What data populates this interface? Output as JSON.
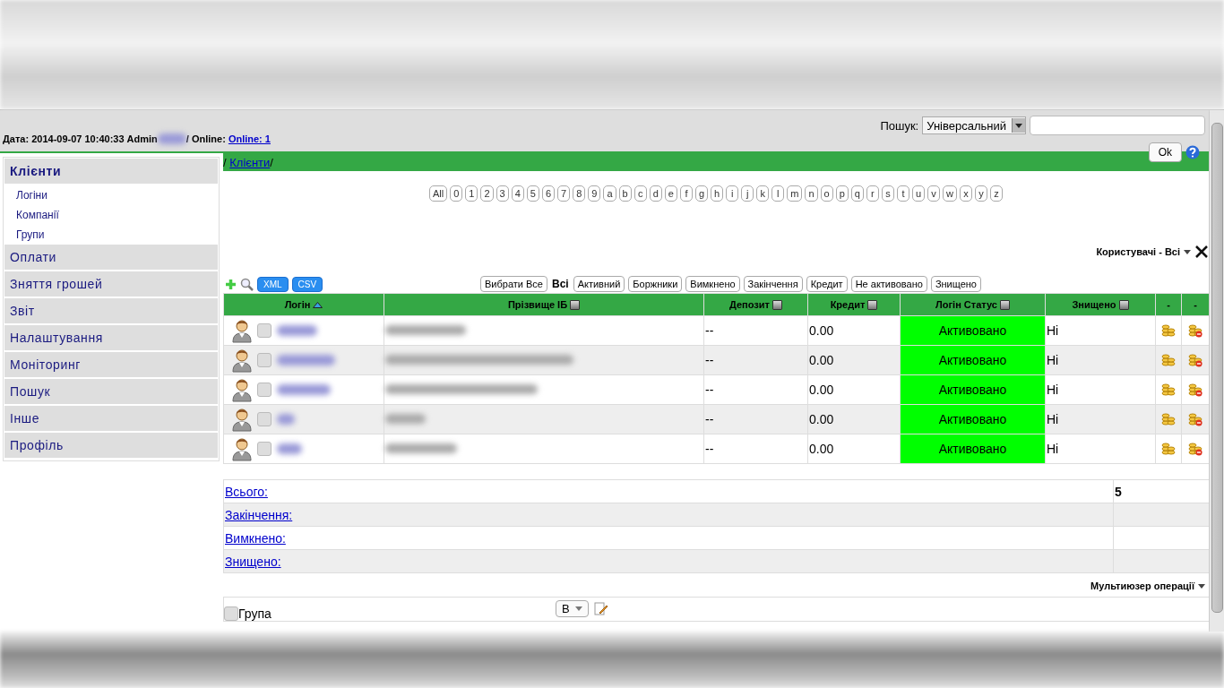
{
  "header": {
    "date_text": "Дата: 2014-09-07 10:40:33 Admin",
    "online_label": "/ Online:",
    "online_link": "Online: 1"
  },
  "search": {
    "label": "Пошук:",
    "mode": "Універсальний",
    "ok": "Ok"
  },
  "sidebar": {
    "items": [
      {
        "label": "Клієнти",
        "expanded": true,
        "children": [
          {
            "label": "Логіни"
          },
          {
            "label": "Компанії"
          },
          {
            "label": "Групи"
          }
        ]
      },
      {
        "label": "Оплати",
        "expanded": false
      },
      {
        "label": "Зняття грошей",
        "expanded": false
      },
      {
        "label": "Звіт",
        "expanded": false
      },
      {
        "label": "Налаштування",
        "expanded": false
      },
      {
        "label": "Моніторинг",
        "expanded": false
      },
      {
        "label": "Пошук",
        "expanded": false
      },
      {
        "label": "Інше",
        "expanded": false
      },
      {
        "label": "Профіль",
        "expanded": false
      }
    ]
  },
  "breadcrumb": {
    "prefix": "/",
    "link": "Клієнти",
    "suffix": "/"
  },
  "letters": [
    "All",
    "0",
    "1",
    "2",
    "3",
    "4",
    "5",
    "6",
    "7",
    "8",
    "9",
    "a",
    "b",
    "c",
    "d",
    "e",
    "f",
    "g",
    "h",
    "i",
    "j",
    "k",
    "l",
    "m",
    "n",
    "o",
    "p",
    "q",
    "r",
    "s",
    "t",
    "u",
    "v",
    "w",
    "x",
    "y",
    "z"
  ],
  "view_title": "Користувачі - Всі",
  "export_buttons": [
    "XML",
    "CSV"
  ],
  "filters": [
    {
      "label": "Вибрати Все",
      "selected": false
    },
    {
      "label": "Всі",
      "selected": true
    },
    {
      "label": "Активний",
      "selected": false
    },
    {
      "label": "Боржники",
      "selected": false
    },
    {
      "label": "Вимкнено",
      "selected": false
    },
    {
      "label": "Закінчення",
      "selected": false
    },
    {
      "label": "Кредит",
      "selected": false
    },
    {
      "label": "Не активовано",
      "selected": false
    },
    {
      "label": "Знищено",
      "selected": false
    }
  ],
  "table": {
    "columns": [
      {
        "label": "Логін",
        "kind": "sort"
      },
      {
        "label": "Прізвище ІБ",
        "kind": "toggle"
      },
      {
        "label": "Депозит",
        "kind": "toggle"
      },
      {
        "label": "Кредит",
        "kind": "toggle"
      },
      {
        "label": "Логін Статус",
        "kind": "toggle"
      },
      {
        "label": "Знищено",
        "kind": "toggle"
      },
      {
        "label": "-",
        "kind": "plain"
      },
      {
        "label": "-",
        "kind": "plain"
      }
    ],
    "rows": [
      {
        "checked": false,
        "deposit": "--",
        "credit": "0.00",
        "status": "Активовано",
        "destroyed": "Ні"
      },
      {
        "checked": false,
        "deposit": "--",
        "credit": "0.00",
        "status": "Активовано",
        "destroyed": "Ні"
      },
      {
        "checked": false,
        "deposit": "--",
        "credit": "0.00",
        "status": "Активовано",
        "destroyed": "Ні"
      },
      {
        "checked": false,
        "deposit": "--",
        "credit": "0.00",
        "status": "Активовано",
        "destroyed": "Ні"
      },
      {
        "checked": false,
        "deposit": "--",
        "credit": "0.00",
        "status": "Активовано",
        "destroyed": "Ні"
      }
    ]
  },
  "summary": [
    {
      "label": "Всього:",
      "value": "5"
    },
    {
      "label": "Закінчення:"
    },
    {
      "label": "Вимкнено:"
    },
    {
      "label": "Знищено:"
    }
  ],
  "multiuser": {
    "title": "Мультиюзер операції",
    "group_label": "Група",
    "group_checked": false,
    "group_value": "В"
  }
}
